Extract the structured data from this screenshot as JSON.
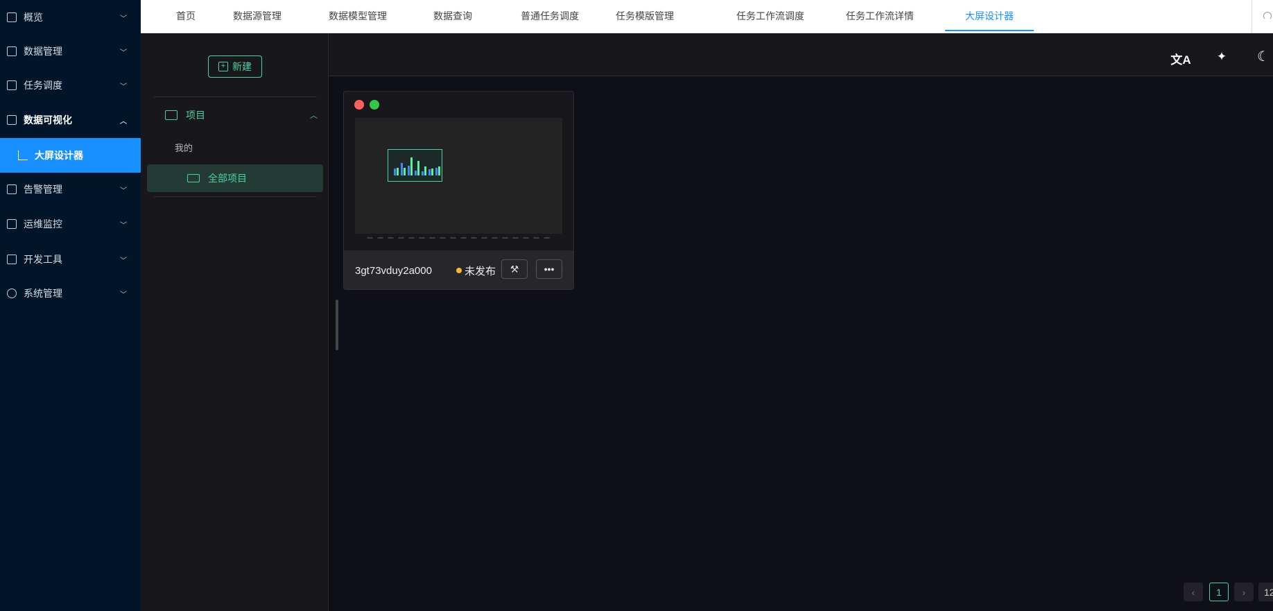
{
  "sidebar": {
    "items": [
      {
        "label": "概览",
        "icon": "grid-icon"
      },
      {
        "label": "数据管理",
        "icon": "database-icon"
      },
      {
        "label": "任务调度",
        "icon": "task-list-icon"
      },
      {
        "label": "数据可视化",
        "icon": "line-chart-icon"
      },
      {
        "label": "大屏设计器",
        "icon": "scatter-chart-icon"
      },
      {
        "label": "告警管理",
        "icon": "alarm-icon"
      },
      {
        "label": "运维监控",
        "icon": "monitor-icon"
      },
      {
        "label": "开发工具",
        "icon": "code-icon"
      },
      {
        "label": "系统管理",
        "icon": "gear-icon"
      }
    ]
  },
  "topnav": {
    "tabs": [
      "首页",
      "数据源管理",
      "数据模型管理",
      "数据查询",
      "普通任务调度",
      "任务模版管理",
      "任务工作流调度",
      "任务工作流详情",
      "大屏设计器"
    ]
  },
  "panel": {
    "new_label": "新建",
    "project_label": "项目",
    "mine_label": "我的",
    "all_projects_label": "全部项目"
  },
  "toolbar": {
    "translate": "文A",
    "wand": "✦",
    "moon": "☾"
  },
  "card": {
    "name": "3gt73vduy2a000",
    "status": "未发布",
    "status_color": "#f7b73b"
  },
  "pagination": {
    "prev": "‹",
    "current": "1",
    "next": "›",
    "page_size": "12"
  }
}
